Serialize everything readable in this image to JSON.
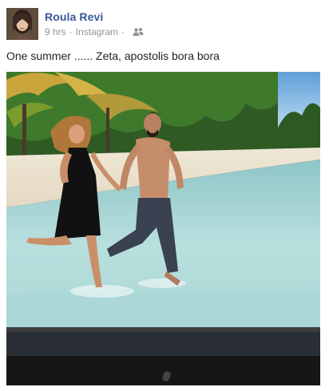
{
  "post": {
    "author": "Roula Revi",
    "timestamp": "9 hrs",
    "separator": "·",
    "source": "Instagram",
    "source_separator": "·",
    "privacy_icon": "friends-icon",
    "caption": "One summer ...... Zeta, apostolis bora bora",
    "photo_subject": "beach-couple-photo"
  },
  "colors": {
    "author_link": "#365899",
    "meta_text": "#90949c",
    "caption_text": "#1d2129"
  }
}
